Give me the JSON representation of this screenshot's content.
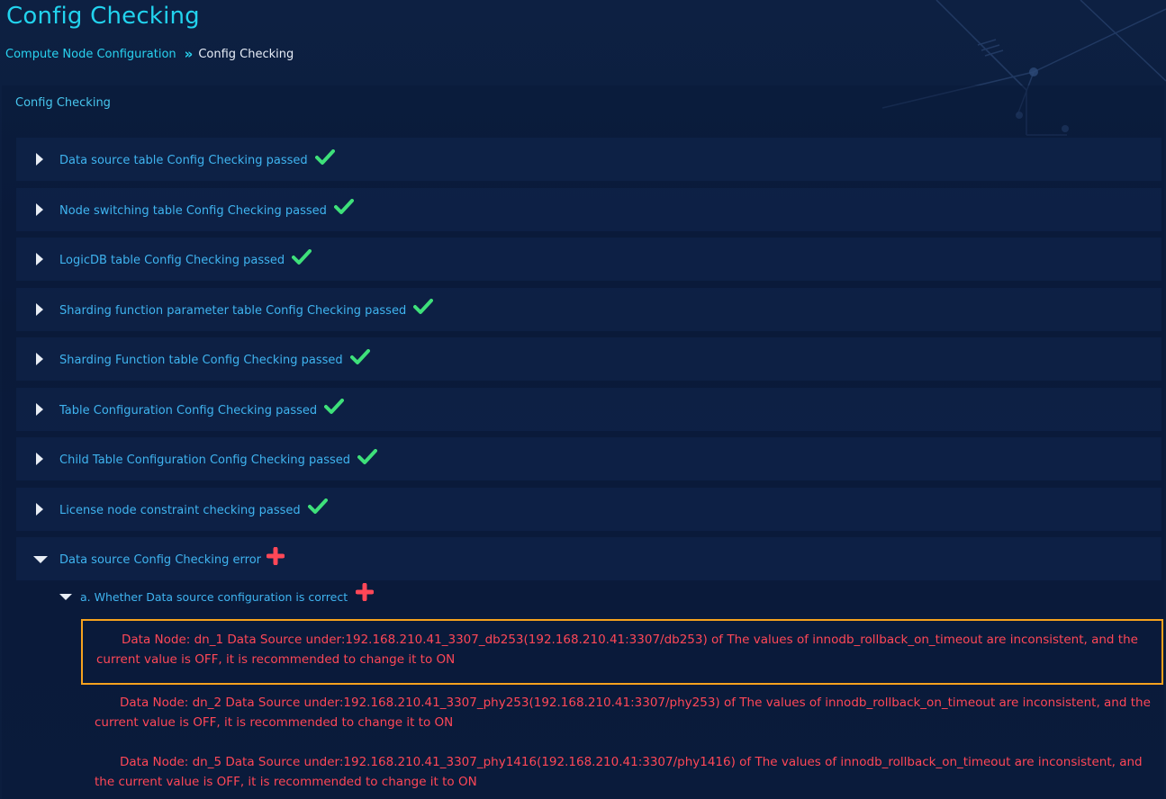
{
  "page": {
    "title": "Config Checking",
    "breadcrumb": {
      "parent": "Compute Node Configuration",
      "separator": "»",
      "current": "Config Checking"
    }
  },
  "panel": {
    "title": "Config Checking",
    "sections": [
      {
        "label": "Data source table Config Checking passed",
        "status": "passed",
        "expanded": false,
        "icon": "check-icon"
      },
      {
        "label": "Node switching table Config Checking passed",
        "status": "passed",
        "expanded": false,
        "icon": "check-icon"
      },
      {
        "label": "LogicDB table Config Checking passed",
        "status": "passed",
        "expanded": false,
        "icon": "check-icon"
      },
      {
        "label": "Sharding function parameter table Config Checking passed",
        "status": "passed",
        "expanded": false,
        "icon": "check-icon"
      },
      {
        "label": "Sharding Function table Config Checking passed",
        "status": "passed",
        "expanded": false,
        "icon": "check-icon"
      },
      {
        "label": "Table Configuration Config Checking passed",
        "status": "passed",
        "expanded": false,
        "icon": "check-icon"
      },
      {
        "label": "Child Table Configuration Config Checking passed",
        "status": "passed",
        "expanded": false,
        "icon": "check-icon"
      },
      {
        "label": "License node constraint checking passed",
        "status": "passed",
        "expanded": false,
        "icon": "check-icon"
      },
      {
        "label": "Data source Config Checking error",
        "status": "error",
        "expanded": true,
        "icon": "plus-icon"
      }
    ],
    "subsection": {
      "label": "a. Whether Data source configuration is correct",
      "icon": "plus-icon",
      "errors": [
        "Data Node: dn_1 Data Source under:192.168.210.41_3307_db253(192.168.210.41:3307/db253) of The values of innodb_rollback_on_timeout are inconsistent, and the current value is OFF, it is recommended to change it to ON",
        "Data Node: dn_2 Data Source under:192.168.210.41_3307_phy253(192.168.210.41:3307/phy253) of The values of innodb_rollback_on_timeout are inconsistent, and the current value is OFF, it is recommended to change it to ON",
        "Data Node: dn_5 Data Source under:192.168.210.41_3307_phy1416(192.168.210.41:3307/phy1416) of The values of innodb_rollback_on_timeout are inconsistent, and the current value is OFF, it is recommended to change it to ON"
      ]
    }
  },
  "colors": {
    "accent": "#22d3ee",
    "label": "#3fb4f0",
    "success": "#3ee07a",
    "error": "#ff4757",
    "highlight_border": "#f6a21e"
  }
}
